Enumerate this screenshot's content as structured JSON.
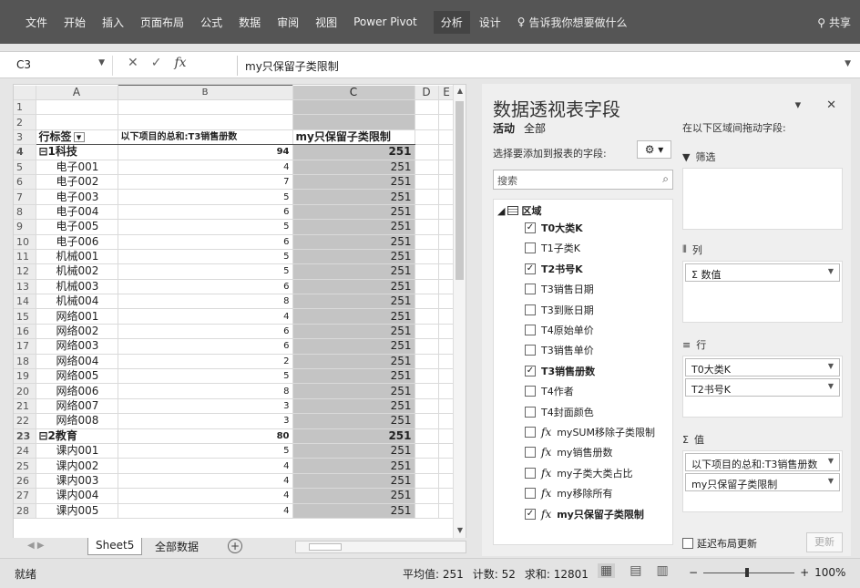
{
  "ribbon": {
    "tabs": [
      "文件",
      "开始",
      "插入",
      "页面布局",
      "公式",
      "数据",
      "审阅",
      "视图",
      "Power Pivot",
      "分析",
      "设计"
    ],
    "tell_me": "告诉我你想要做什么",
    "share": "共享"
  },
  "formula_bar": {
    "name_box": "C3",
    "formula": "my只保留子类限制"
  },
  "grid": {
    "columns": [
      "A",
      "B",
      "C",
      "D",
      "E"
    ],
    "header_row": {
      "a": "行标签",
      "b": "以下项目的总和:T3销售册数",
      "c": "my只保留子类限制"
    },
    "rows": [
      {
        "n": "1",
        "a": "",
        "b": "",
        "c": ""
      },
      {
        "n": "2",
        "a": "",
        "b": "",
        "c": ""
      },
      {
        "n": "4",
        "a": "⊟1科技",
        "b": "94",
        "c": "251",
        "group": true
      },
      {
        "n": "5",
        "a": "电子001",
        "b": "4",
        "c": "251"
      },
      {
        "n": "6",
        "a": "电子002",
        "b": "7",
        "c": "251"
      },
      {
        "n": "7",
        "a": "电子003",
        "b": "5",
        "c": "251"
      },
      {
        "n": "8",
        "a": "电子004",
        "b": "6",
        "c": "251"
      },
      {
        "n": "9",
        "a": "电子005",
        "b": "5",
        "c": "251"
      },
      {
        "n": "10",
        "a": "电子006",
        "b": "6",
        "c": "251"
      },
      {
        "n": "11",
        "a": "机械001",
        "b": "5",
        "c": "251"
      },
      {
        "n": "12",
        "a": "机械002",
        "b": "5",
        "c": "251"
      },
      {
        "n": "13",
        "a": "机械003",
        "b": "6",
        "c": "251"
      },
      {
        "n": "14",
        "a": "机械004",
        "b": "8",
        "c": "251"
      },
      {
        "n": "15",
        "a": "网络001",
        "b": "4",
        "c": "251"
      },
      {
        "n": "16",
        "a": "网络002",
        "b": "6",
        "c": "251"
      },
      {
        "n": "17",
        "a": "网络003",
        "b": "6",
        "c": "251"
      },
      {
        "n": "18",
        "a": "网络004",
        "b": "2",
        "c": "251"
      },
      {
        "n": "19",
        "a": "网络005",
        "b": "5",
        "c": "251"
      },
      {
        "n": "20",
        "a": "网络006",
        "b": "8",
        "c": "251"
      },
      {
        "n": "21",
        "a": "网络007",
        "b": "3",
        "c": "251"
      },
      {
        "n": "22",
        "a": "网络008",
        "b": "3",
        "c": "251"
      },
      {
        "n": "23",
        "a": "⊟2教育",
        "b": "80",
        "c": "251",
        "group": true
      },
      {
        "n": "24",
        "a": "课内001",
        "b": "5",
        "c": "251"
      },
      {
        "n": "25",
        "a": "课内002",
        "b": "4",
        "c": "251"
      },
      {
        "n": "26",
        "a": "课内003",
        "b": "4",
        "c": "251"
      },
      {
        "n": "27",
        "a": "课内004",
        "b": "4",
        "c": "251"
      },
      {
        "n": "28",
        "a": "课内005",
        "b": "4",
        "c": "251"
      }
    ]
  },
  "sheet_tabs": [
    "Sheet5",
    "全部数据"
  ],
  "pivot_pane": {
    "title": "数据透视表字段",
    "tab_active": "活动",
    "tab_all": "全部",
    "choose_label": "选择要添加到报表的字段:",
    "search_placeholder": "搜索",
    "root": "区域",
    "fields": [
      {
        "label": "T0大类K",
        "checked": true,
        "fx": false
      },
      {
        "label": "T1子类K",
        "checked": false,
        "fx": false
      },
      {
        "label": "T2书号K",
        "checked": true,
        "fx": false
      },
      {
        "label": "T3销售日期",
        "checked": false,
        "fx": false
      },
      {
        "label": "T3到账日期",
        "checked": false,
        "fx": false
      },
      {
        "label": "T4原始单价",
        "checked": false,
        "fx": false
      },
      {
        "label": "T3销售单价",
        "checked": false,
        "fx": false
      },
      {
        "label": "T3销售册数",
        "checked": true,
        "fx": false
      },
      {
        "label": "T4作者",
        "checked": false,
        "fx": false
      },
      {
        "label": "T4封面颜色",
        "checked": false,
        "fx": false
      },
      {
        "label": "mySUM移除子类限制",
        "checked": false,
        "fx": true
      },
      {
        "label": "my销售册数",
        "checked": false,
        "fx": true
      },
      {
        "label": "my子类大类占比",
        "checked": false,
        "fx": true
      },
      {
        "label": "my移除所有",
        "checked": false,
        "fx": true
      },
      {
        "label": "my只保留子类限制",
        "checked": true,
        "fx": true
      }
    ],
    "drag_label": "在以下区域间拖动字段:",
    "filter_title": "筛选",
    "columns_title": "列",
    "columns_item": "Σ 数值",
    "rows_title": "行",
    "rows_items": [
      "T0大类K",
      "T2书号K"
    ],
    "values_title": "值",
    "values_items": [
      "以下项目的总和:T3销售册数",
      "my只保留子类限制"
    ],
    "defer_label": "延迟布局更新",
    "update_label": "更新"
  },
  "status_bar": {
    "ready": "就绪",
    "average": "平均值: 251",
    "count": "计数: 52",
    "sum": "求和: 12801",
    "zoom": "100%"
  }
}
